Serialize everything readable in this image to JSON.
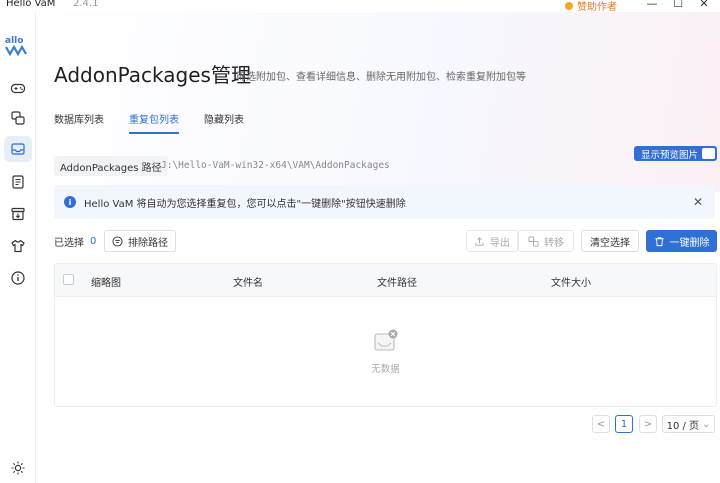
{
  "titlebar": {
    "app_name": "Hello VaM",
    "version": "2.4.1",
    "sponsor_label": "赞助作者",
    "minimize": "—",
    "maximize": "☐",
    "close": "✕"
  },
  "sidebar": {
    "logo_text": "allo",
    "items": [
      {
        "icon": "gamepad-icon"
      },
      {
        "icon": "swap-icon"
      },
      {
        "icon": "package-inbox-icon",
        "active": true
      },
      {
        "icon": "document-list-icon"
      },
      {
        "icon": "archive-download-icon"
      },
      {
        "icon": "shirt-icon"
      },
      {
        "icon": "info-icon"
      }
    ],
    "settings_icon": "sun-settings-icon"
  },
  "header": {
    "title": "AddonPackages管理",
    "description": "筛选附加包、查看详细信息、删除无用附加包、检索重复附加包等"
  },
  "tabs": [
    {
      "label": "数据库列表",
      "active": false
    },
    {
      "label": "重复包列表",
      "active": true
    },
    {
      "label": "隐藏列表",
      "active": false
    }
  ],
  "path": {
    "label": "AddonPackages 路径",
    "value": "J:\\Hello-VaM-win32-x64\\VAM\\AddonPackages"
  },
  "preview_toggle": {
    "label": "显示预览图片",
    "on": true
  },
  "alert": {
    "text": "Hello VaM 将自动为您选择重复包，您可以点击\"一键删除\"按钮快速删除",
    "close": "✕"
  },
  "toolbar": {
    "selected_label": "已选择",
    "selected_count": "0",
    "exclude_path": "排除路径",
    "export": "导出",
    "transfer": "转移",
    "clear_selection": "清空选择",
    "delete_all": "一键删除"
  },
  "table": {
    "columns": [
      "缩略图",
      "文件名",
      "文件路径",
      "文件大小"
    ],
    "rows": [],
    "empty_text": "无数据"
  },
  "pagination": {
    "prev": "<",
    "current_page": "1",
    "next": ">",
    "page_size": "10 / 页",
    "page_size_arrow": "⌄"
  },
  "colors": {
    "accent": "#2f6fd6",
    "sponsor": "#e07a1f"
  }
}
